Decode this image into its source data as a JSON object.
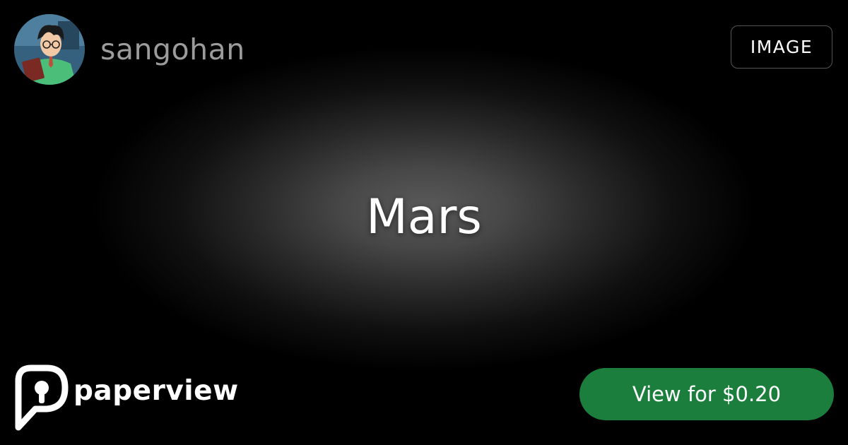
{
  "header": {
    "username": "sangohan",
    "avatar_icon": "avatar-illustration",
    "content_type": "IMAGE"
  },
  "main": {
    "title": "Mars"
  },
  "footer": {
    "brand_name": "paperview",
    "brand_icon": "paperview-logo-icon",
    "cta_label": "View for $0.20",
    "cta_color": "#1c7e3d"
  },
  "colors": {
    "background": "#000000",
    "glow": "#5a5a5a",
    "username": "#9c9c9c",
    "text": "#ffffff"
  }
}
